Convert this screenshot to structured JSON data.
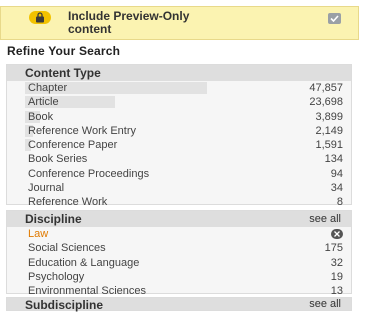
{
  "preview": {
    "label_line1": "Include Preview-Only",
    "label_line2": "content",
    "checked": true
  },
  "refine_title": "Refine Your Search",
  "content_type": {
    "title": "Content Type",
    "items": [
      {
        "label": "Chapter",
        "count": "47,857",
        "share": 1.0
      },
      {
        "label": "Article",
        "count": "23,698",
        "share": 0.495
      },
      {
        "label": "Book",
        "count": "3,899",
        "share": 0.081
      },
      {
        "label": "Reference Work Entry",
        "count": "2,149",
        "share": 0.045
      },
      {
        "label": "Conference Paper",
        "count": "1,591",
        "share": 0.033
      },
      {
        "label": "Book Series",
        "count": "134",
        "share": 0.003
      },
      {
        "label": "Conference Proceedings",
        "count": "94",
        "share": 0.002
      },
      {
        "label": "Journal",
        "count": "34",
        "share": 0.001
      },
      {
        "label": "Reference Work",
        "count": "8",
        "share": 0.0
      }
    ]
  },
  "discipline": {
    "title": "Discipline",
    "see_all": "see all",
    "items": [
      {
        "label": "Law",
        "selected": true
      },
      {
        "label": "Social Sciences",
        "count": "175"
      },
      {
        "label": "Education & Language",
        "count": "32"
      },
      {
        "label": "Psychology",
        "count": "19"
      },
      {
        "label": "Environmental Sciences",
        "count": "13"
      }
    ]
  },
  "subdiscipline": {
    "title": "Subdiscipline",
    "see_all": "see all"
  },
  "colors": {
    "preview_bg": "#fbf3b1",
    "selected": "#e07a00",
    "panel_header": "#dedede"
  }
}
